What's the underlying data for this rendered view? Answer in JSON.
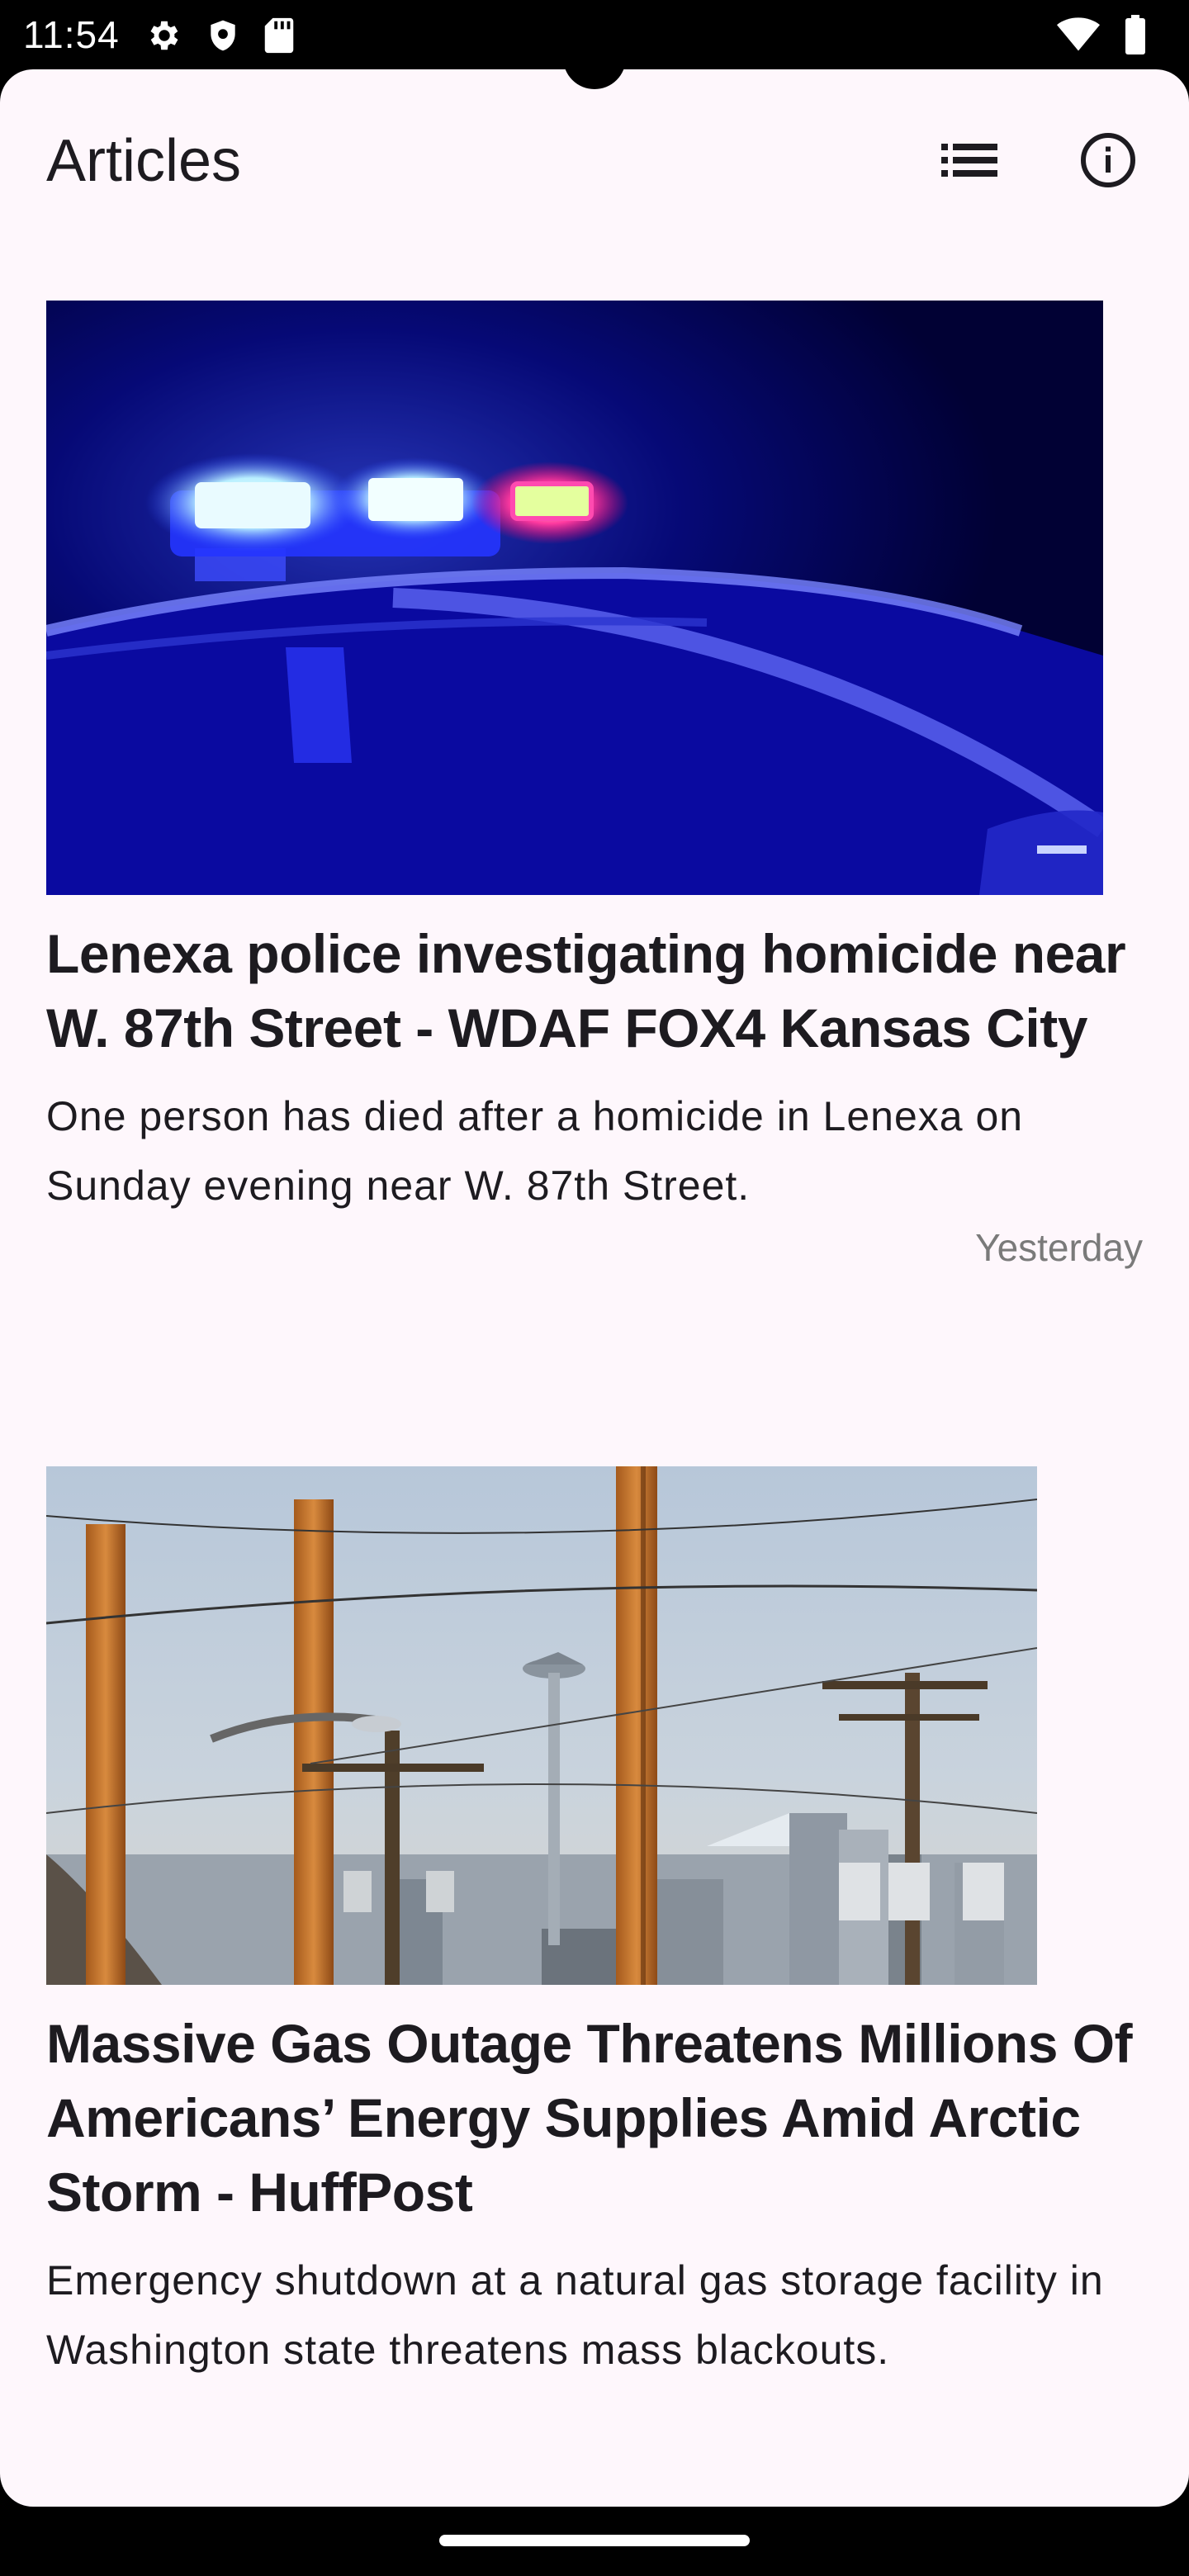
{
  "status_bar": {
    "time": "11:54",
    "left_icons": [
      "settings-icon",
      "shield-icon",
      "sd-card-icon"
    ],
    "right_icons": [
      "wifi-icon",
      "battery-icon"
    ]
  },
  "app_bar": {
    "title": "Articles",
    "actions": [
      "list-view-icon",
      "info-icon"
    ]
  },
  "articles": [
    {
      "image": "police-lights-photo",
      "title": "Lenexa police investigating homicide near W. 87th Street - WDAF FOX4 Kansas City",
      "description": "One person has died after a homicide in Lenexa on Sunday evening near W. 87th Street.",
      "date": "Yesterday"
    },
    {
      "image": "smokestacks-seattle-photo",
      "title": "Massive Gas Outage Threatens Millions Of Americans’ Energy Supplies Amid Arctic Storm - HuffPost",
      "description": "Emergency shutdown at a natural gas storage facility in Washington state threatens mass blackouts."
    }
  ],
  "colors": {
    "background": "#fef7fc",
    "text": "#1d1b20",
    "date": "#7a7a7a"
  }
}
